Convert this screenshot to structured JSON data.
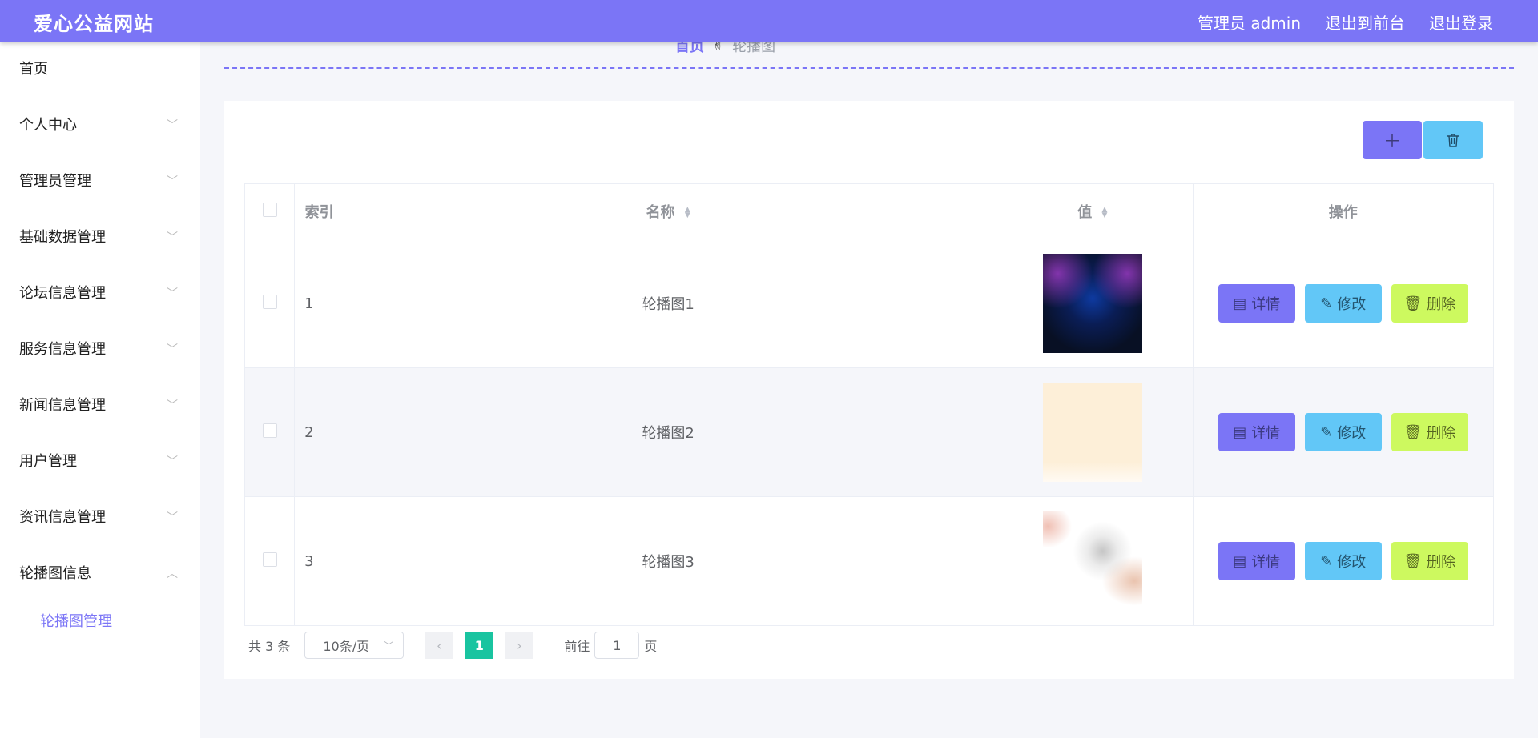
{
  "header": {
    "title": "爱心公益网站",
    "admin_label": "管理员 admin",
    "front_label": "退出到前台",
    "logout_label": "退出登录",
    "accent_color": "#7b75f6"
  },
  "sidebar": {
    "items": [
      {
        "label": "首页"
      },
      {
        "label": "个人中心"
      },
      {
        "label": "管理员管理"
      },
      {
        "label": "基础数据管理"
      },
      {
        "label": "论坛信息管理"
      },
      {
        "label": "服务信息管理"
      },
      {
        "label": "新闻信息管理"
      },
      {
        "label": "用户管理"
      },
      {
        "label": "资讯信息管理"
      },
      {
        "label": "轮播图信息"
      }
    ],
    "sub_item": "轮播图管理"
  },
  "breadcrumb": {
    "home": "首页",
    "separator_icon": "hand-icon",
    "current": "轮播图"
  },
  "toolbar": {
    "add_symbol": "＋",
    "delete_icon": "trash-icon"
  },
  "table": {
    "headers": {
      "index": "索引",
      "name": "名称",
      "value": "值",
      "actions": "操作"
    },
    "rows": [
      {
        "index": "1",
        "name": "轮播图1",
        "thumb": "dark-blue-abstract-image"
      },
      {
        "index": "2",
        "name": "轮播图2",
        "thumb": "cream-gradient-image"
      },
      {
        "index": "3",
        "name": "轮播图3",
        "thumb": "white-swirl-image"
      }
    ],
    "actions": {
      "detail": "详情",
      "edit": "修改",
      "remove": "删除"
    }
  },
  "pagination": {
    "total": "共 3 条",
    "page_size": "10条/页",
    "current_page": "1",
    "goto_label": "前往",
    "goto_value": "1",
    "page_suffix": "页"
  }
}
